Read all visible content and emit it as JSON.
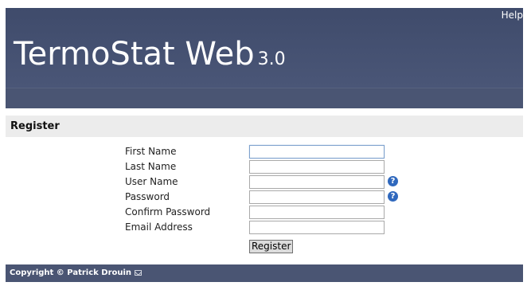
{
  "header": {
    "help_label": "Help",
    "app_name": "TermoStat Web",
    "app_version": "3.0"
  },
  "section": {
    "title": "Register"
  },
  "form": {
    "fields": [
      {
        "label": "First Name",
        "value": "",
        "has_help": false,
        "focused": true
      },
      {
        "label": "Last Name",
        "value": "",
        "has_help": false,
        "focused": false
      },
      {
        "label": "User Name",
        "value": "",
        "has_help": true,
        "focused": false
      },
      {
        "label": "Password",
        "value": "",
        "has_help": true,
        "focused": false
      },
      {
        "label": "Confirm Password",
        "value": "",
        "has_help": false,
        "focused": false
      },
      {
        "label": "Email Address",
        "value": "",
        "has_help": false,
        "focused": false
      }
    ],
    "help_icon_glyph": "?",
    "submit_label": "Register"
  },
  "footer": {
    "copyright": "Copyright © Patrick Drouin",
    "mail_icon": "envelope-icon"
  },
  "colors": {
    "header_bg": "#3f4b6b",
    "section_bg": "#ececec",
    "help_icon": "#2f68bd",
    "footer_bg": "#4a5573"
  }
}
